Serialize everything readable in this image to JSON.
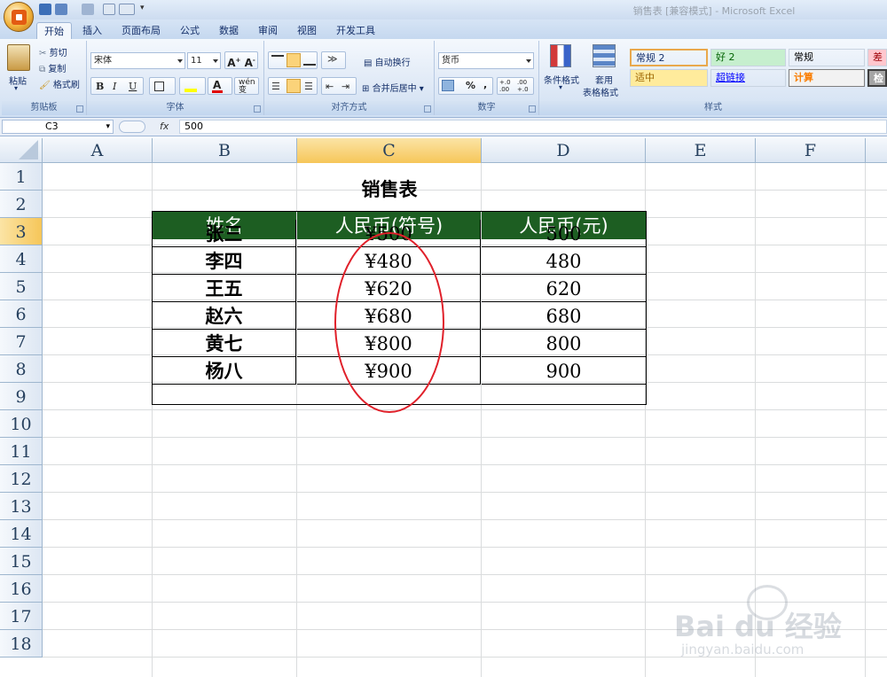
{
  "window": {
    "title": "销售表 [兼容模式] - Microsoft Excel"
  },
  "tabs": [
    "开始",
    "插入",
    "页面布局",
    "公式",
    "数据",
    "审阅",
    "视图",
    "开发工具"
  ],
  "ribbon": {
    "clipboard": {
      "label": "剪贴板",
      "paste": "粘贴",
      "cut": "剪切",
      "copy": "复制",
      "format_painter": "格式刷"
    },
    "font": {
      "label": "字体",
      "font_name": "宋体",
      "font_size": "11",
      "bold": "B",
      "italic": "I",
      "underline": "U",
      "wen": "wén\n变"
    },
    "alignment": {
      "label": "对齐方式",
      "wrap_text": "自动换行",
      "merge_center": "合并后居中"
    },
    "number": {
      "label": "数字",
      "format": "货币",
      "percent": "%",
      "comma": ",",
      "inc_decimal": "+.0\n.00",
      "dec_decimal": ".00\n+.0"
    },
    "styles": {
      "label": "样式",
      "conditional": "条件格式",
      "table_format_1": "套用",
      "table_format_2": "表格格式",
      "cells": [
        {
          "text": "常规 2",
          "bg": "#ffffff",
          "color": "#000000"
        },
        {
          "text": "好 2",
          "bg": "#c6efce",
          "color": "#006100"
        },
        {
          "text": "常规",
          "bg": "#ffffff",
          "color": "#000000"
        },
        {
          "text": "差",
          "bg": "#ffc7ce",
          "color": "#9c0006"
        },
        {
          "text": "适中",
          "bg": "#ffeb9c",
          "color": "#9c6500"
        },
        {
          "text": "超链接",
          "bg": "#ffffff",
          "color": "#0000ff"
        },
        {
          "text": "计算",
          "bg": "#f2f2f2",
          "color": "#fa7d00"
        },
        {
          "text": "检查",
          "bg": "#a5a5a5",
          "color": "#ffffff"
        }
      ]
    }
  },
  "formula_bar": {
    "name_box": "C3",
    "fx": "fx",
    "value": "500"
  },
  "columns": [
    "A",
    "B",
    "C",
    "D",
    "E",
    "F"
  ],
  "rows": [
    "1",
    "2",
    "3",
    "4",
    "5",
    "6",
    "7",
    "8",
    "9",
    "10",
    "11",
    "12",
    "13",
    "14",
    "15",
    "16",
    "17",
    "18"
  ],
  "sheet": {
    "title": "销售表",
    "headers": [
      "姓名",
      "人民币(符号)",
      "人民币(元)"
    ],
    "data": [
      [
        "张三",
        "¥500",
        "500"
      ],
      [
        "李四",
        "¥480",
        "480"
      ],
      [
        "王五",
        "¥620",
        "620"
      ],
      [
        "赵六",
        "¥680",
        "680"
      ],
      [
        "黄七",
        "¥800",
        "800"
      ],
      [
        "杨八",
        "¥900",
        "900"
      ]
    ]
  },
  "watermark": {
    "brand": "Bai du 经验",
    "url": "jingyan.baidu.com"
  },
  "colors": {
    "header_fill": "#1d5e22",
    "ellipse": "#e0202a"
  }
}
